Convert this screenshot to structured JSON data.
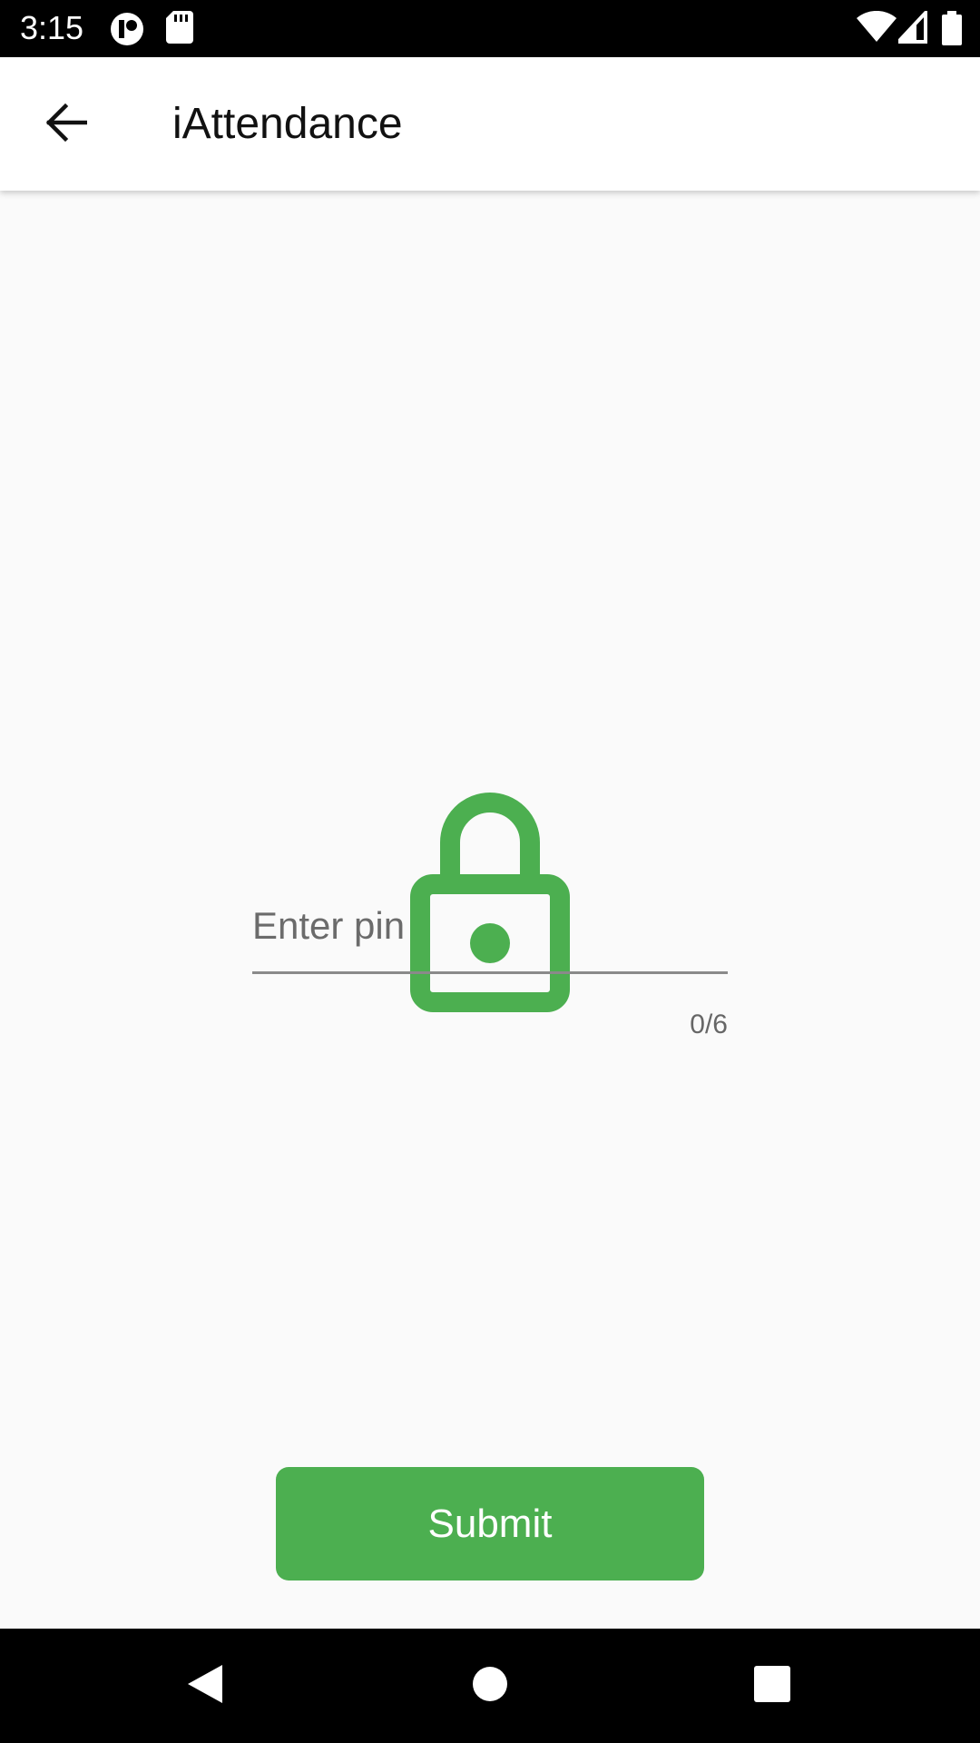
{
  "status_bar": {
    "time": "3:15",
    "left_icons": [
      "notification-app-icon",
      "sd-card-icon"
    ],
    "right_icons": [
      "wifi-icon",
      "signal-icon",
      "battery-icon"
    ]
  },
  "app_bar": {
    "title": "iAttendance",
    "back_icon": "arrow-back-icon"
  },
  "main": {
    "lock_icon": "lock-icon",
    "pin_input": {
      "placeholder": "Enter pin",
      "value": "",
      "counter": "0/6"
    },
    "submit_label": "Submit"
  },
  "nav_bar": {
    "back_icon": "nav-back-icon",
    "home_icon": "nav-home-icon",
    "recents_icon": "nav-recents-icon"
  },
  "colors": {
    "accent": "#4caf50",
    "status_bar": "#000000",
    "app_bar": "#ffffff",
    "background": "#fafafa"
  }
}
